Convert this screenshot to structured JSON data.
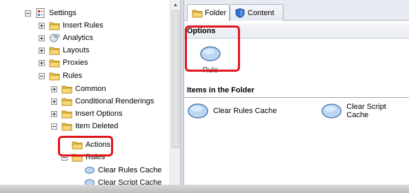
{
  "tree": {
    "items": [
      {
        "label": "Settings",
        "toggle": "minus",
        "icon": "settings-icon"
      },
      {
        "label": "Insert Rules",
        "toggle": "plus",
        "icon": "folder-icon"
      },
      {
        "label": "Analytics",
        "toggle": "plus",
        "icon": "analytics-icon"
      },
      {
        "label": "Layouts",
        "toggle": "plus",
        "icon": "folder-icon"
      },
      {
        "label": "Proxies",
        "toggle": "plus",
        "icon": "folder-icon"
      },
      {
        "label": "Rules",
        "toggle": "minus",
        "icon": "folder-icon"
      },
      {
        "label": "Common",
        "toggle": "plus",
        "icon": "folder-icon"
      },
      {
        "label": "Conditional Renderings",
        "toggle": "plus",
        "icon": "folder-icon"
      },
      {
        "label": "Insert Options",
        "toggle": "plus",
        "icon": "folder-icon"
      },
      {
        "label": "Item Deleted",
        "toggle": "minus",
        "icon": "folder-icon"
      },
      {
        "label": "Actions",
        "toggle": "none",
        "icon": "folder-icon"
      },
      {
        "label": "Rules",
        "toggle": "minus",
        "icon": "folder-icon"
      },
      {
        "label": "Clear Rules Cache",
        "toggle": "none",
        "icon": "rule-icon"
      },
      {
        "label": "Clear Script Cache",
        "toggle": "none",
        "icon": "rule-icon"
      }
    ]
  },
  "tabs": [
    {
      "label": "Folder",
      "icon": "folder-icon",
      "active": true
    },
    {
      "label": "Content",
      "icon": "content-shield-icon",
      "active": false
    }
  ],
  "options": {
    "heading": "Options",
    "rule_label": "Rule"
  },
  "items_section": {
    "heading": "Items in the Folder",
    "entries": [
      {
        "label": "Clear Rules Cache",
        "icon": "rule-icon"
      },
      {
        "label": "Clear Script Cache",
        "icon": "rule-icon"
      }
    ]
  },
  "scrollbar": {
    "up_arrow": "▲"
  },
  "colors": {
    "callout": "#e0141b",
    "folder": "#f2c24c",
    "rule_oval": "#bcd6f3"
  }
}
